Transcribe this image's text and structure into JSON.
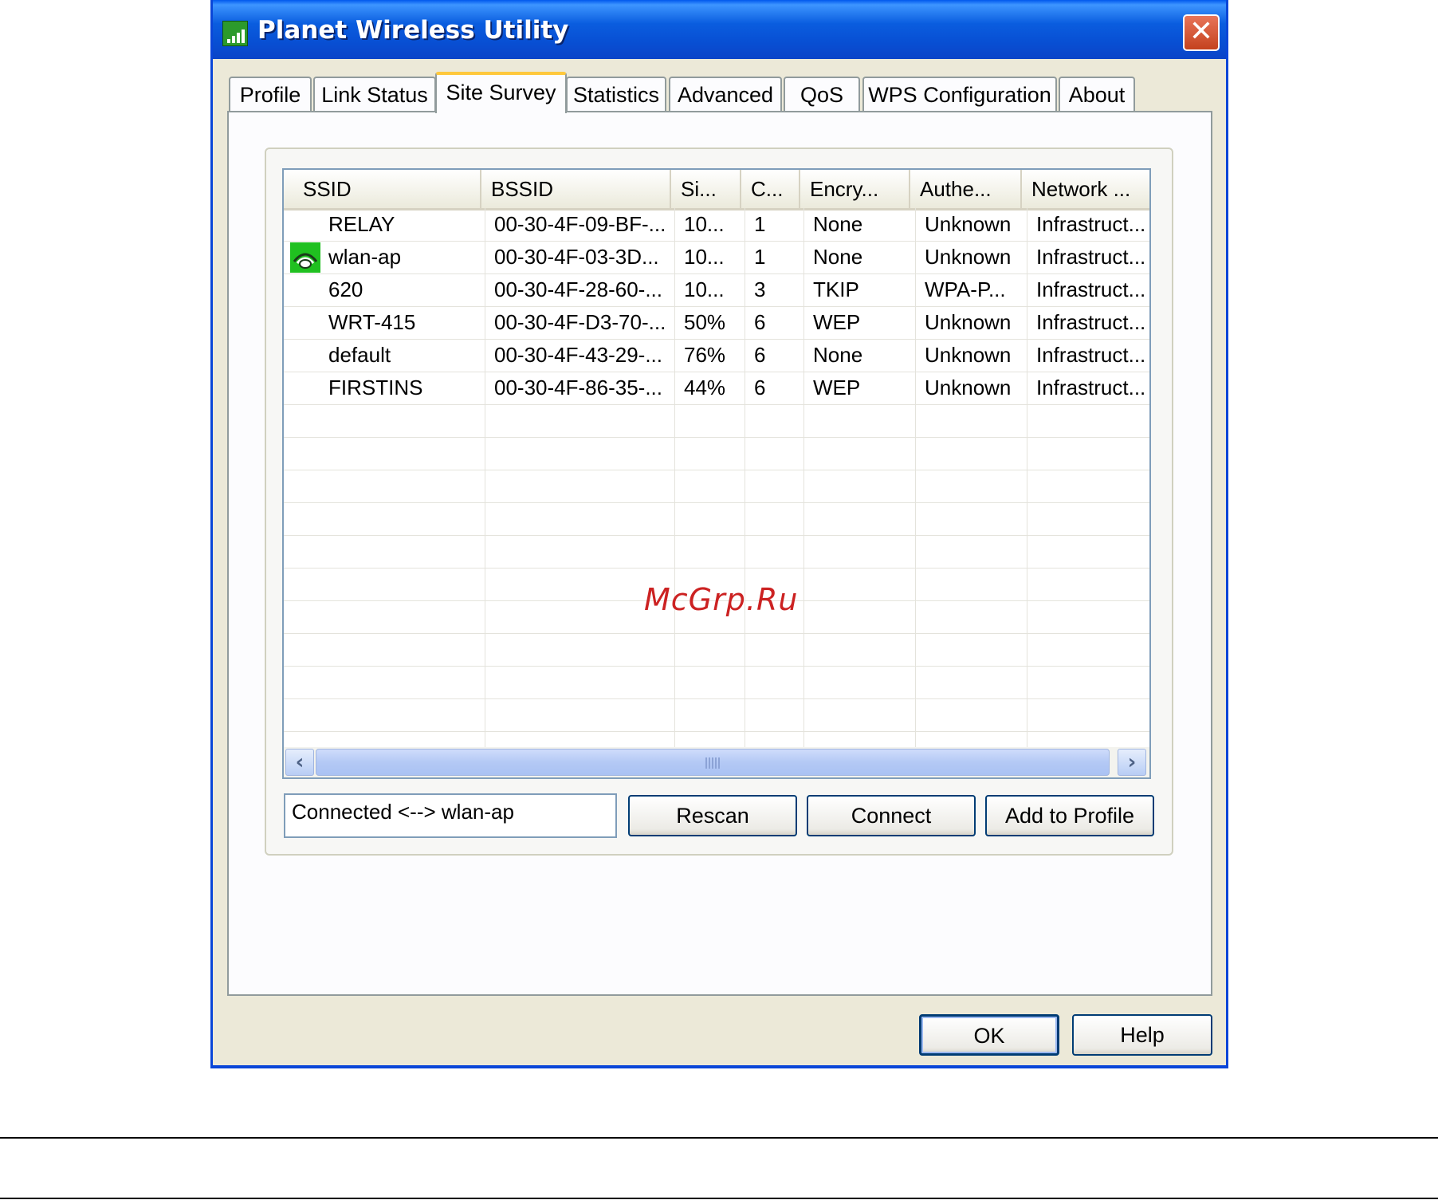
{
  "window": {
    "title": "Planet Wireless Utility"
  },
  "tabs": [
    {
      "label": "Profile"
    },
    {
      "label": "Link Status"
    },
    {
      "label": "Site Survey"
    },
    {
      "label": "Statistics"
    },
    {
      "label": "Advanced"
    },
    {
      "label": "QoS"
    },
    {
      "label": "WPS Configuration"
    },
    {
      "label": "About"
    }
  ],
  "active_tab": "Site Survey",
  "site_survey": {
    "columns": [
      "SSID",
      "BSSID",
      "Si...",
      "C...",
      "Encry...",
      "Authe...",
      "Network ..."
    ],
    "rows": [
      {
        "ssid": "RELAY",
        "bssid": "00-30-4F-09-BF-...",
        "signal": "10...",
        "channel": "1",
        "encryption": "None",
        "auth": "Unknown",
        "network": "Infrastruct...",
        "connected": false
      },
      {
        "ssid": "wlan-ap",
        "bssid": "00-30-4F-03-3D...",
        "signal": "10...",
        "channel": "1",
        "encryption": "None",
        "auth": "Unknown",
        "network": "Infrastruct...",
        "connected": true
      },
      {
        "ssid": "620",
        "bssid": "00-30-4F-28-60-...",
        "signal": "10...",
        "channel": "3",
        "encryption": "TKIP",
        "auth": "WPA-P...",
        "network": "Infrastruct...",
        "connected": false
      },
      {
        "ssid": "WRT-415",
        "bssid": "00-30-4F-D3-70-...",
        "signal": "50%",
        "channel": "6",
        "encryption": "WEP",
        "auth": "Unknown",
        "network": "Infrastruct...",
        "connected": false
      },
      {
        "ssid": "default",
        "bssid": "00-30-4F-43-29-...",
        "signal": "76%",
        "channel": "6",
        "encryption": "None",
        "auth": "Unknown",
        "network": "Infrastruct...",
        "connected": false
      },
      {
        "ssid": "FIRSTINS",
        "bssid": "00-30-4F-86-35-...",
        "signal": "44%",
        "channel": "6",
        "encryption": "WEP",
        "auth": "Unknown",
        "network": "Infrastruct...",
        "connected": false
      }
    ],
    "status_text": "Connected <--> wlan-ap",
    "buttons": {
      "rescan": "Rescan",
      "connect": "Connect",
      "add_to_profile": "Add to Profile"
    }
  },
  "footer": {
    "ok": "OK",
    "help": "Help"
  },
  "watermark": "McGrp.Ru",
  "icons": {
    "app": "signal-bars-icon",
    "close": "close-icon",
    "connected": "connected-network-icon",
    "scroll_left": "chevron-left-icon",
    "scroll_right": "chevron-right-icon"
  },
  "colors": {
    "title_bar": "#0a5ddf",
    "active_tab_accent": "#ffc83c",
    "connected_icon": "#20c020",
    "watermark": "#cc2222"
  }
}
